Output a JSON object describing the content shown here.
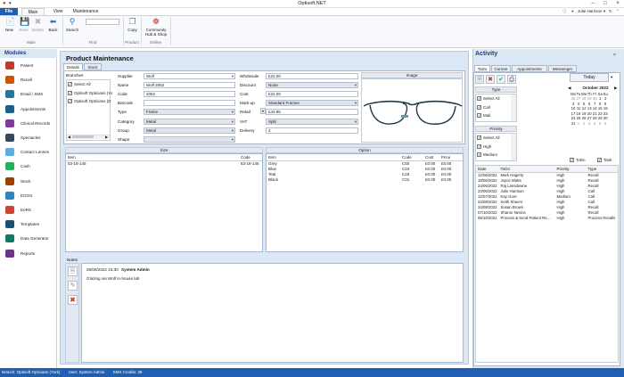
{
  "window": {
    "title": "Optisoft.NET"
  },
  "ribbon_tabs": [
    "File",
    "Main",
    "View",
    "Maintenance"
  ],
  "user": {
    "name": "Julie Harrison"
  },
  "ribbon": {
    "buttons": [
      {
        "label": "New",
        "icon": "new-icon"
      },
      {
        "label": "Save",
        "icon": "save-icon"
      },
      {
        "label": "Delete",
        "icon": "delete-icon"
      },
      {
        "label": "Back",
        "icon": "back-icon"
      },
      {
        "label": "Search",
        "icon": "search-icon"
      },
      {
        "label": "Copy",
        "icon": "copy-icon"
      },
      {
        "label": "Community Hub & Shop",
        "icon": "community-icon"
      }
    ],
    "groups": [
      "Main",
      "Find",
      "Product",
      "Online"
    ]
  },
  "modules": {
    "title": "Modules",
    "items": [
      {
        "label": "Patient",
        "color": "#c0392b"
      },
      {
        "label": "Recall",
        "color": "#d35400"
      },
      {
        "label": "Email / SMS",
        "color": "#2874a6"
      },
      {
        "label": "Appointments",
        "color": "#1f618d"
      },
      {
        "label": "Clinical Records",
        "color": "#7d3c98"
      },
      {
        "label": "Spectacles",
        "color": "#34495e"
      },
      {
        "label": "Contact Lenses",
        "color": "#5dade2"
      },
      {
        "label": "Cash",
        "color": "#27ae60"
      },
      {
        "label": "Stock",
        "color": "#a04000"
      },
      {
        "label": "EGOS",
        "color": "#2e86c1"
      },
      {
        "label": "EeRS",
        "color": "#cb4335"
      },
      {
        "label": "Templates",
        "color": "#1a5276"
      },
      {
        "label": "Data Generator",
        "color": "#117a65"
      },
      {
        "label": "Reports",
        "color": "#6c3483"
      }
    ]
  },
  "product": {
    "title": "Product Maintenance",
    "tabs": [
      "Details",
      "Stock"
    ],
    "branches": {
      "label": "Branches",
      "items": [
        "Select All",
        "Optisoft Opticians (Yo",
        "Optisoft Opticians (D"
      ]
    },
    "fields_left": [
      {
        "label": "Supplier",
        "value": "Wolf",
        "type": "combo"
      },
      {
        "label": "Name",
        "value": "Wolf 2052",
        "type": "input"
      },
      {
        "label": "Code",
        "value": "2052",
        "type": "input"
      },
      {
        "label": "Barcode",
        "value": "",
        "type": "input"
      },
      {
        "label": "Type",
        "value": "Frame",
        "type": "combo"
      },
      {
        "label": "Category",
        "value": "Metal",
        "type": "combo"
      },
      {
        "label": "Group",
        "value": "Metal",
        "type": "combo"
      },
      {
        "label": "Shape",
        "value": "",
        "type": "combo"
      }
    ],
    "fields_right": [
      {
        "label": "Wholesale",
        "value": "£22.00",
        "type": "input"
      },
      {
        "label": "Discount",
        "value": "None",
        "type": "combo"
      },
      {
        "label": "Cost",
        "value": "£22.00",
        "type": "input"
      },
      {
        "label": "Mark-up",
        "value": "Standard Frames",
        "type": "combo"
      },
      {
        "label": "Retail",
        "value": "£43.95",
        "type": "input"
      },
      {
        "label": "VAT",
        "value": "Split",
        "type": "combo"
      },
      {
        "label": "Delivery",
        "value": "2",
        "type": "input"
      }
    ],
    "image_label": "Image",
    "size": {
      "title": "Size",
      "headers": [
        "Item",
        "Code"
      ],
      "rows": [
        [
          "53-18-145",
          "53-18-145"
        ]
      ]
    },
    "option": {
      "title": "Option",
      "headers": [
        "Item",
        "Code",
        "Cost",
        "Price"
      ],
      "rows": [
        [
          "Grey",
          "C50",
          "£0.00",
          "£0.00"
        ],
        [
          "Blue",
          "C10",
          "£0.00",
          "£0.00"
        ],
        [
          "Teal",
          "C18",
          "£0.00",
          "£0.00"
        ],
        [
          "Black",
          "C01",
          "£0.00",
          "£0.00"
        ]
      ]
    },
    "notes": {
      "label": "Notes",
      "date": "26/08/2022 15:30",
      "author": "System Admin",
      "text": "Glazing via Wolf in-house lab"
    }
  },
  "activity": {
    "title": "Activity",
    "tabs": [
      "ToDo",
      "Current",
      "Appointments",
      "Messenger"
    ],
    "today_label": "Today",
    "type_label": "Type",
    "type_items": [
      "Select All",
      "Call",
      "Mail"
    ],
    "priority_label": "Priority",
    "priority_items": [
      "Select All",
      "High",
      "Medium"
    ],
    "calendar": {
      "title": "October 2022",
      "days": [
        "Mo",
        "Tu",
        "We",
        "Th",
        "Fr",
        "Sa",
        "Su"
      ],
      "weeks": [
        [
          "26",
          "27",
          "28",
          "29",
          "30",
          "1",
          "2"
        ],
        [
          "3",
          "4",
          "5",
          "6",
          "7",
          "8",
          "9"
        ],
        [
          "10",
          "11",
          "12",
          "13",
          "14",
          "15",
          "16"
        ],
        [
          "17",
          "18",
          "19",
          "20",
          "21",
          "22",
          "23"
        ],
        [
          "24",
          "25",
          "26",
          "27",
          "28",
          "29",
          "30"
        ],
        [
          "31",
          "1",
          "2",
          "3",
          "4",
          "5",
          "6"
        ]
      ]
    },
    "filters": [
      "ToDo",
      "Task"
    ],
    "todo_headers": [
      "Date",
      "ToDo",
      "Priority",
      "Type"
    ],
    "todos": [
      [
        "12/06/2022",
        "Mark Hagerty",
        "High",
        "Recall"
      ],
      [
        "18/06/2022",
        "Joyce Watts",
        "High",
        "Recall"
      ],
      [
        "24/06/2022",
        "Raj Lansdowne",
        "High",
        "Recall"
      ],
      [
        "23/06/2022",
        "Julie Harrison",
        "High",
        "Call"
      ],
      [
        "12/07/2022",
        "Kay Gore",
        "Medium",
        "Call"
      ],
      [
        "24/08/2022",
        "Keith Sheers",
        "High",
        "Call"
      ],
      [
        "24/08/2022",
        "Susan Brown",
        "High",
        "Recall"
      ],
      [
        "07/10/2022",
        "Sharon Nevins",
        "High",
        "Recall"
      ],
      [
        "06/10/2022",
        "Process & Send Patient Re...",
        "High",
        "Process Recalls"
      ]
    ]
  },
  "status": [
    "Branch: Optisoft Opticians (York)",
    "User: System Admin",
    "SMS Credits: 38"
  ]
}
